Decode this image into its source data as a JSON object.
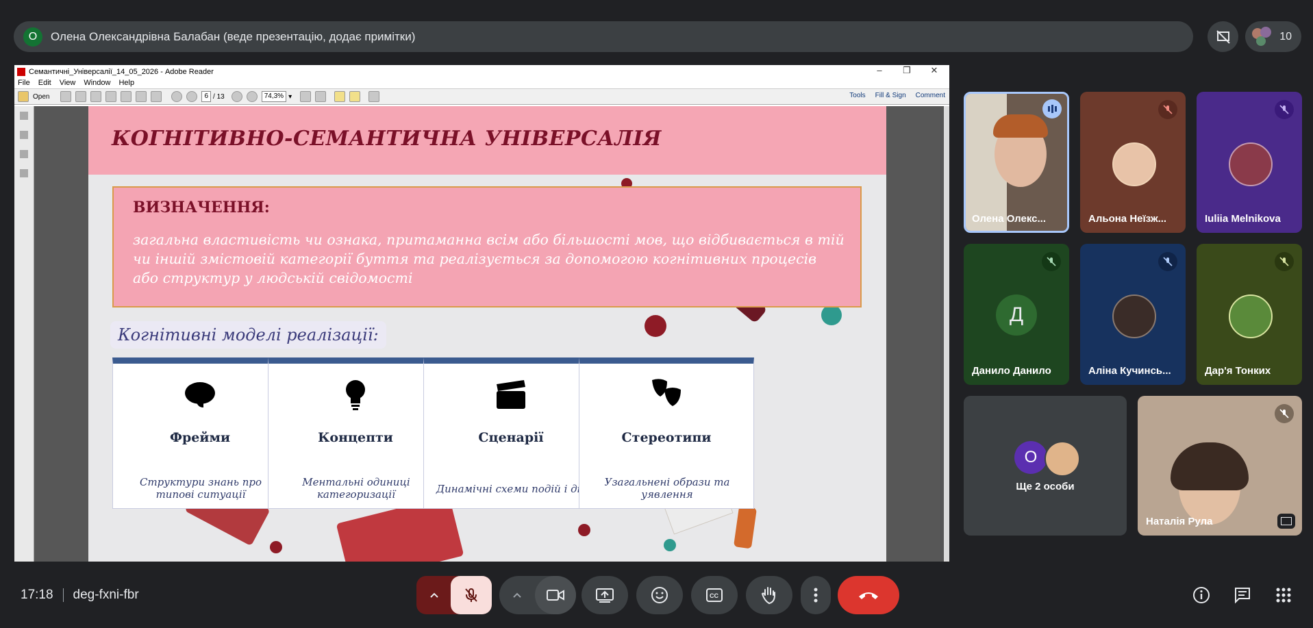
{
  "presenter": {
    "avatar_letter": "О",
    "text": "Олена Олександрівна Балабан (веде презентацію, додає примітки)"
  },
  "participants_count": "10",
  "adobe": {
    "title": "Семантичні_Універсалії_14_05_2026 - Adobe Reader",
    "menu": [
      "File",
      "Edit",
      "View",
      "Window",
      "Help"
    ],
    "open_label": "Open",
    "page_current": "6",
    "page_total": "/ 13",
    "zoom": "74,3%",
    "tools": "Tools",
    "fill_sign": "Fill & Sign",
    "comment": "Comment"
  },
  "slide": {
    "title": "КОГНІТИВНО-СЕМАНТИЧНА УНІВЕРСАЛІЯ",
    "definition_label": "ВИЗНАЧЕННЯ:",
    "definition_text": "загальна властивість чи ознака, притаманна всім або більшості мов, що відбивається в тій чи іншій змістовій категорії буття та реалізується за допомогою когнітивних процесів або структур у людській свідомості",
    "models_label": "Когнітивні моделі реалізації:",
    "cards": [
      {
        "title": "Фрейми",
        "desc": "Структури знань про типові ситуації",
        "icon": "brain-icon"
      },
      {
        "title": "Концепти",
        "desc": "Ментальні одиниці категоризації",
        "icon": "lightbulb-icon"
      },
      {
        "title": "Сценарії",
        "desc": "Динамічні схеми подій і дій",
        "icon": "clapperboard-icon"
      },
      {
        "title": "Стереотипи",
        "desc": "Узагальнені образи та уявлення",
        "icon": "masks-icon"
      }
    ]
  },
  "tiles": [
    {
      "name": "Олена Олекс...",
      "color": "#6b5a4e"
    },
    {
      "name": "Альона Неїзж...",
      "color": "#6d3a2c"
    },
    {
      "name": "Iuliia Melnikova",
      "color": "#4a2a8a"
    },
    {
      "name": "Данило Данило",
      "avatar_letter": "Д",
      "color": "#1e4620"
    },
    {
      "name": "Аліна Кучинсь...",
      "color": "#17325e"
    },
    {
      "name": "Дар'я Тонких",
      "color": "#3a4a1a"
    },
    {
      "name": "Ще 2 особи",
      "avatar_letter": "О",
      "color": "#3c4043"
    },
    {
      "name": "Наталія Рула",
      "color": "#b9a592"
    }
  ],
  "bottom": {
    "time": "17:18",
    "meeting_code": "deg-fxni-fbr"
  }
}
